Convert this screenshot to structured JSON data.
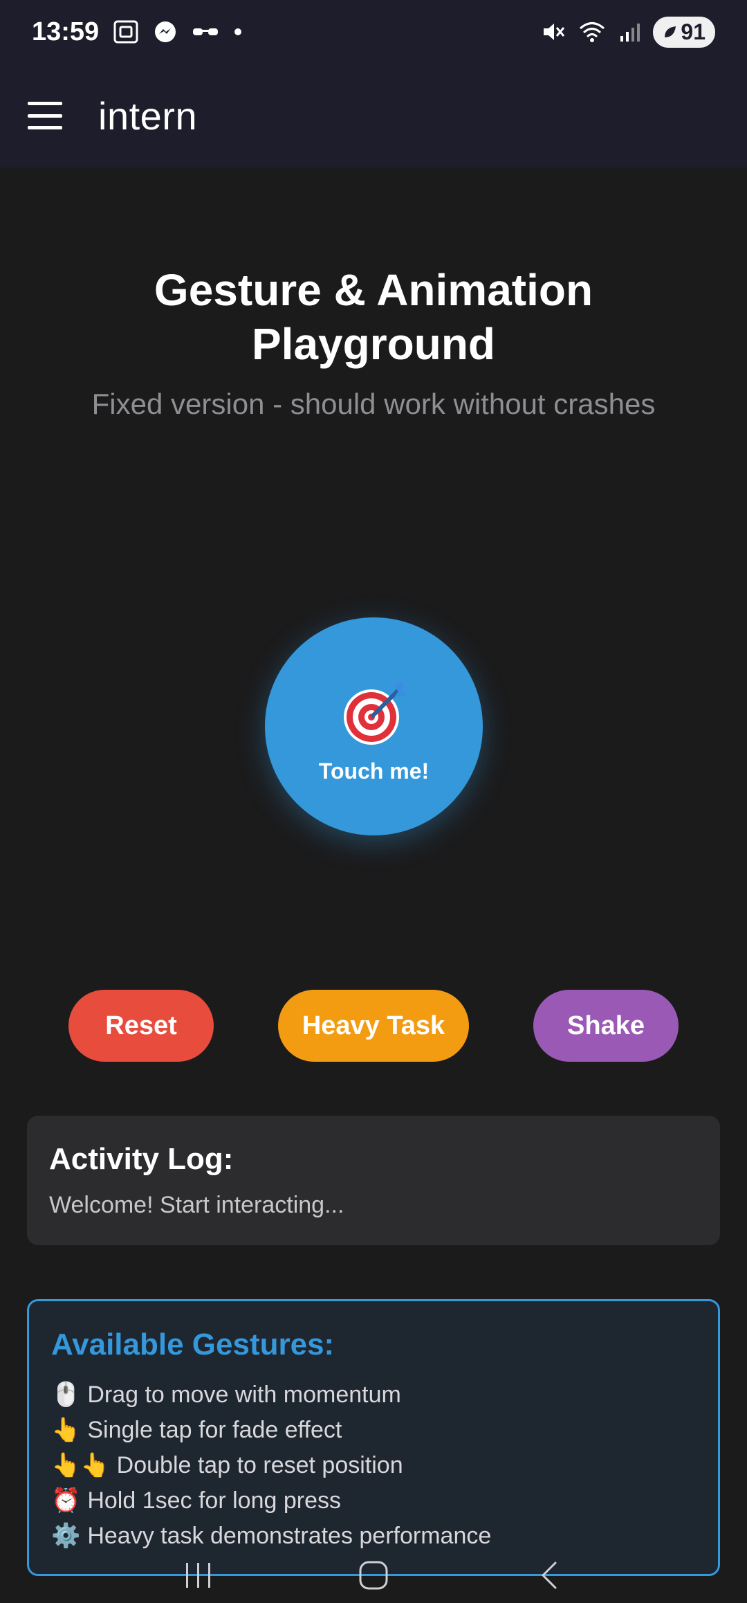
{
  "status_bar": {
    "time": "13:59",
    "battery": "91"
  },
  "app_bar": {
    "title": "intern"
  },
  "main": {
    "title_line1": "Gesture & Animation",
    "title_line2": "Playground",
    "subtitle": "Fixed version - should work without crashes",
    "touch_label": "Touch me!"
  },
  "buttons": {
    "reset": "Reset",
    "heavy_task": "Heavy Task",
    "shake": "Shake"
  },
  "colors": {
    "accent_blue": "#3498db",
    "reset_red": "#e74c3c",
    "heavy_orange": "#f39c12",
    "shake_purple": "#9b59b6"
  },
  "activity_log": {
    "title": "Activity Log:",
    "text": "Welcome! Start interacting..."
  },
  "gestures": {
    "title": "Available Gestures:",
    "items": [
      {
        "icon": "mouse-icon",
        "emoji": "🖱️",
        "text": "Drag to move with momentum"
      },
      {
        "icon": "pointing-hand-icon",
        "emoji": "👆",
        "text": "Single tap for fade effect"
      },
      {
        "icon": "double-pointing-hand-icon",
        "emoji": "👆👆",
        "text": "Double tap to reset position"
      },
      {
        "icon": "alarm-clock-icon",
        "emoji": "⏰",
        "text": "Hold 1sec for long press"
      },
      {
        "icon": "gear-icon",
        "emoji": "⚙️",
        "text": "Heavy task demonstrates performance"
      }
    ]
  }
}
